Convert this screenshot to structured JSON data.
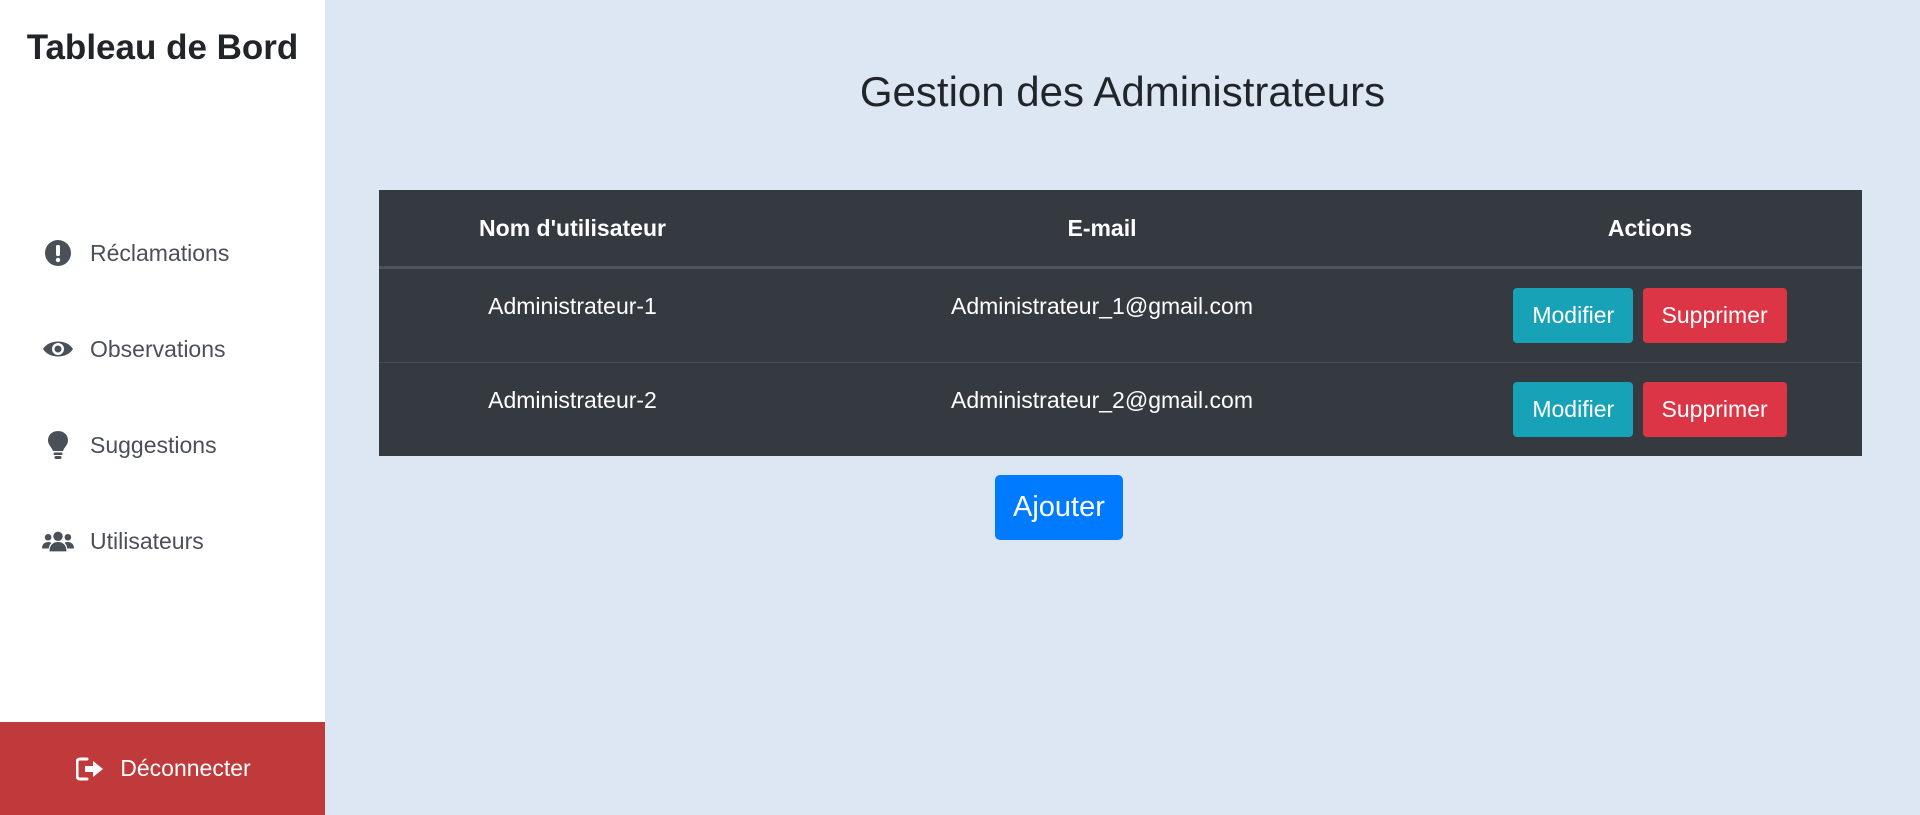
{
  "sidebar": {
    "brand": "Tableau de Bord",
    "items": [
      {
        "label": "Réclamations",
        "icon": "exclamation-circle-icon"
      },
      {
        "label": "Observations",
        "icon": "eye-icon"
      },
      {
        "label": "Suggestions",
        "icon": "lightbulb-icon"
      },
      {
        "label": "Utilisateurs",
        "icon": "users-icon"
      }
    ],
    "logout_label": "Déconnecter",
    "logout_icon": "sign-out-icon"
  },
  "main": {
    "title": "Gestion des Administrateurs",
    "table": {
      "headers": [
        "Nom d'utilisateur",
        "E-mail",
        "Actions"
      ],
      "rows": [
        {
          "username": "Administrateur-1",
          "email": "Administrateur_1@gmail.com"
        },
        {
          "username": "Administrateur-2",
          "email": "Administrateur_2@gmail.com"
        }
      ],
      "edit_label": "Modifier",
      "delete_label": "Supprimer"
    },
    "add_label": "Ajouter"
  },
  "colors": {
    "background": "#dde7f4",
    "table": "#343a40",
    "info": "#17a2b8",
    "danger": "#dc3545",
    "primary": "#007bff",
    "logout": "#c0393b"
  }
}
